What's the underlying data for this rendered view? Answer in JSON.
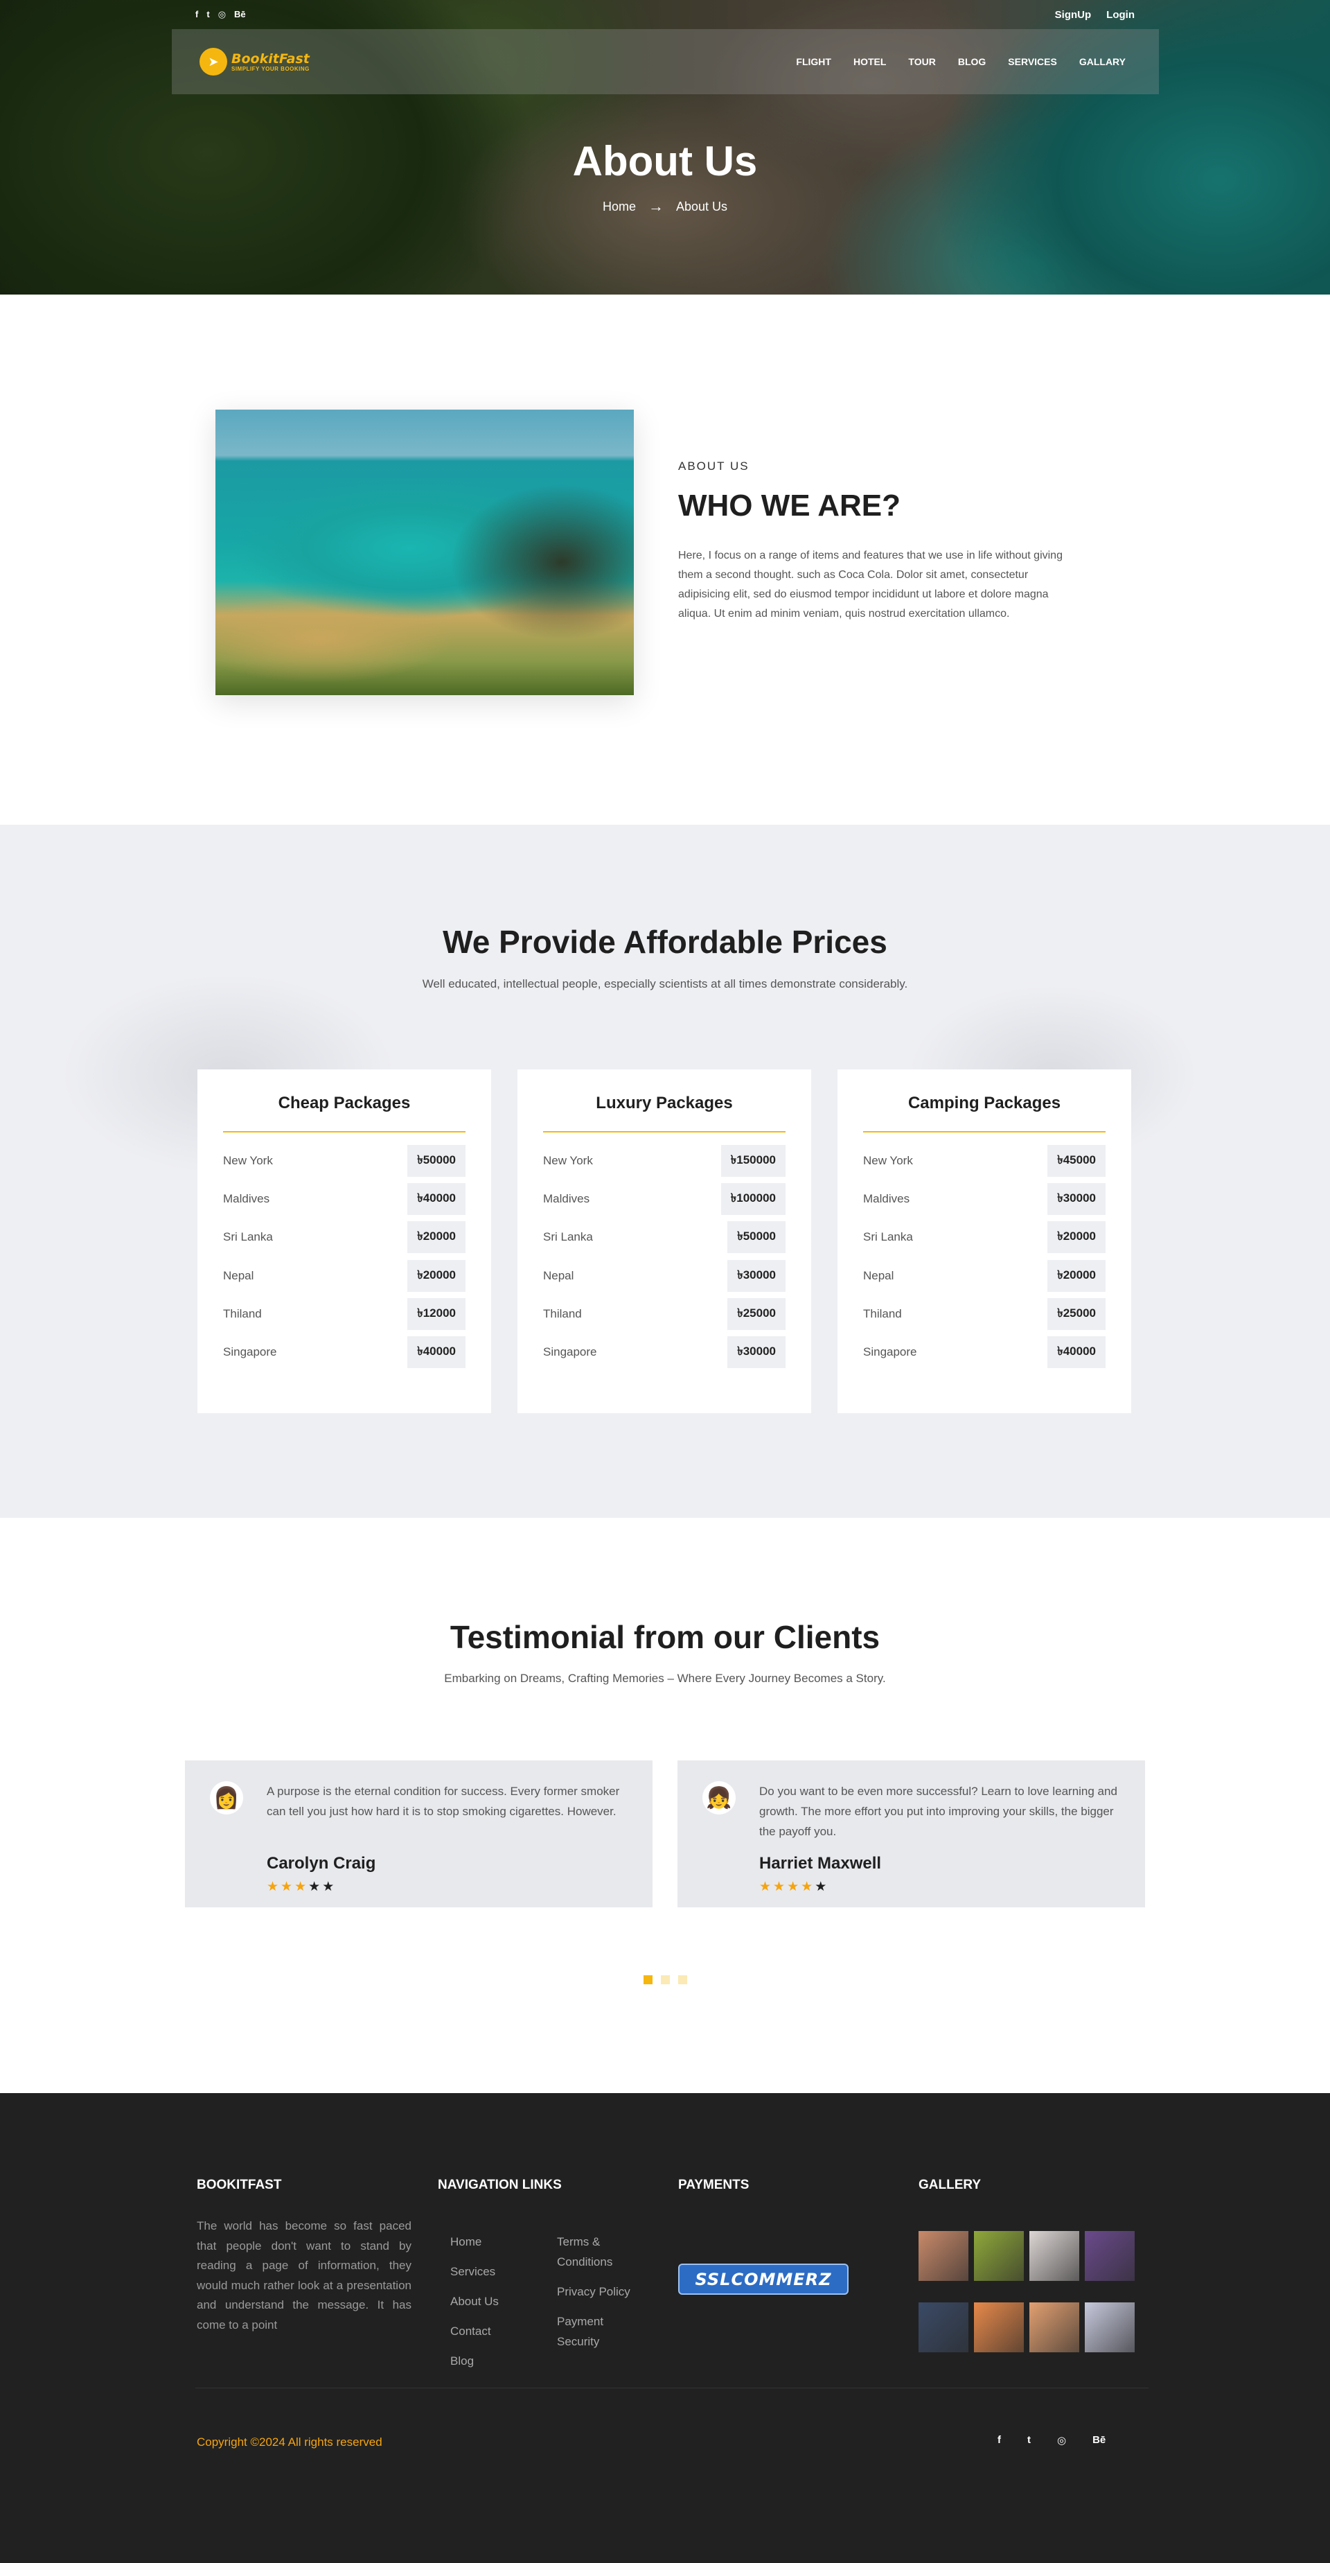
{
  "topbar": {
    "social": [
      "f",
      "t",
      "◎",
      "Bē"
    ],
    "signup": "SignUp",
    "login": "Login"
  },
  "nav": {
    "logo_name": "BookitFast",
    "logo_tag": "SIMPLIFY YOUR BOOKING",
    "items": [
      "FLIGHT",
      "HOTEL",
      "TOUR",
      "BLOG",
      "SERVICES",
      "GALLARY"
    ]
  },
  "hero": {
    "title": "About Us",
    "breadcrumb_home": "Home",
    "breadcrumb_current": "About Us"
  },
  "about": {
    "eyebrow": "ABOUT US",
    "heading": "WHO WE ARE?",
    "body": "Here, I focus on a range of items and features that we use in life without giving them a second thought. such as Coca Cola. Dolor sit amet, consectetur adipisicing elit, sed do eiusmod tempor incididunt ut labore et dolore magna aliqua. Ut enim ad minim veniam, quis nostrud exercitation ullamco."
  },
  "prices": {
    "title": "We Provide Affordable Prices",
    "subtitle": "Well educated, intellectual people, especially scientists at all times demonstrate considerably.",
    "packages": [
      {
        "title": "Cheap Packages",
        "rows": [
          {
            "city": "New York",
            "price": "৳50000"
          },
          {
            "city": "Maldives",
            "price": "৳40000"
          },
          {
            "city": "Sri Lanka",
            "price": "৳20000"
          },
          {
            "city": "Nepal",
            "price": "৳20000"
          },
          {
            "city": "Thiland",
            "price": "৳12000"
          },
          {
            "city": "Singapore",
            "price": "৳40000"
          }
        ]
      },
      {
        "title": "Luxury Packages",
        "rows": [
          {
            "city": "New York",
            "price": "৳150000"
          },
          {
            "city": "Maldives",
            "price": "৳100000"
          },
          {
            "city": "Sri Lanka",
            "price": "৳50000"
          },
          {
            "city": "Nepal",
            "price": "৳30000"
          },
          {
            "city": "Thiland",
            "price": "৳25000"
          },
          {
            "city": "Singapore",
            "price": "৳30000"
          }
        ]
      },
      {
        "title": "Camping Packages",
        "rows": [
          {
            "city": "New York",
            "price": "৳45000"
          },
          {
            "city": "Maldives",
            "price": "৳30000"
          },
          {
            "city": "Sri Lanka",
            "price": "৳20000"
          },
          {
            "city": "Nepal",
            "price": "৳20000"
          },
          {
            "city": "Thiland",
            "price": "৳25000"
          },
          {
            "city": "Singapore",
            "price": "৳40000"
          }
        ]
      }
    ]
  },
  "testimonials": {
    "title": "Testimonial from our Clients",
    "subtitle": "Embarking on Dreams, Crafting Memories – Where Every Journey Becomes a Story.",
    "items": [
      {
        "quote": "A purpose is the eternal condition for success. Every former smoker can tell you just how hard it is to stop smoking cigarettes. However.",
        "name": "Carolyn Craig",
        "rating": 3,
        "max": 5,
        "avatar_icon": "woman-avatar-icon"
      },
      {
        "quote": "Do you want to be even more successful? Learn to love learning and growth. The more effort you put into improving your skills, the bigger the payoff you.",
        "name": "Harriet Maxwell",
        "rating": 4,
        "max": 5,
        "avatar_icon": "girl-avatar-icon"
      }
    ],
    "active_dot": 0,
    "dot_count": 3
  },
  "footer": {
    "about_head": "BOOKITFAST",
    "about_text": "The world has become so fast paced that people don't want to stand by reading a page of information, they would much rather look at a presentation and understand the message. It has come to a point",
    "nav_head": "NAVIGATION LINKS",
    "nav_col1": [
      "Home",
      "Services",
      "About Us",
      "Contact",
      "Blog"
    ],
    "nav_col2": [
      "Terms & Conditions",
      "Privacy Policy",
      "Payment Security"
    ],
    "payments_head": "PAYMENTS",
    "payment_logo": "SSLCOMMERZ",
    "gallery_head": "GALLERY",
    "gallery_colors": [
      "#c98a6a",
      "#8fa83a",
      "#dcd6d4",
      "#6a4a8c",
      "#3a4a66",
      "#e8894a",
      "#e2a071",
      "#c7c9dd"
    ],
    "copyright": "Copyright ©2024 All rights reserved",
    "social": [
      "f",
      "t",
      "◎",
      "Bē"
    ]
  }
}
